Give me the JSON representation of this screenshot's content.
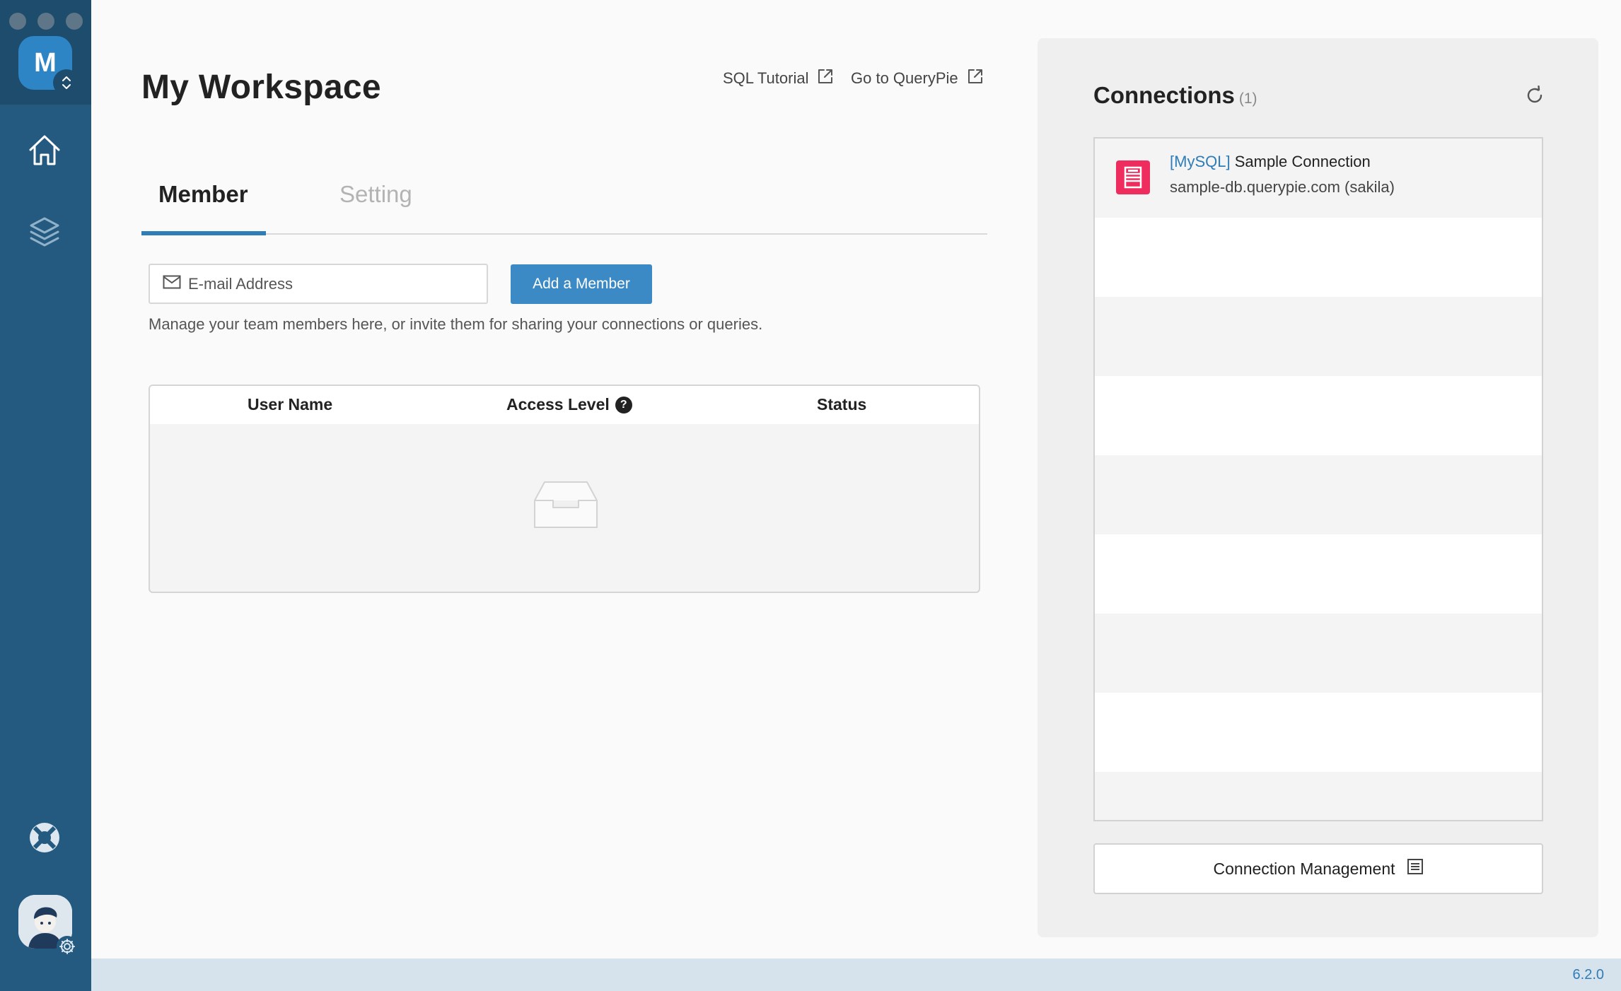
{
  "sidebar": {
    "workspace_initial": "M",
    "nav_items": [
      {
        "name": "home",
        "icon": "home-icon"
      },
      {
        "name": "layers",
        "icon": "layers-icon"
      }
    ],
    "help_icon": "lifebuoy-icon",
    "settings_icon": "gear-icon"
  },
  "header": {
    "title": "My Workspace",
    "links": [
      {
        "label": "SQL Tutorial",
        "icon": "external-link-icon"
      },
      {
        "label": "Go to QueryPie",
        "icon": "external-link-icon"
      }
    ]
  },
  "tabs": [
    {
      "label": "Member",
      "active": true
    },
    {
      "label": "Setting",
      "active": false
    }
  ],
  "member": {
    "email_placeholder": "E-mail Address",
    "email_value": "",
    "add_button": "Add a Member",
    "help_text": "Manage your team members here, or invite them for sharing your connections or queries.",
    "table": {
      "columns": [
        "User Name",
        "Access Level",
        "Status"
      ],
      "access_help": "?",
      "rows": []
    }
  },
  "connections": {
    "title": "Connections",
    "count": "(1)",
    "items": [
      {
        "type_label": "[MySQL]",
        "name": "Sample Connection",
        "host": "sample-db.querypie.com (sakila)"
      }
    ],
    "management_button": "Connection Management"
  },
  "status_bar": {
    "version": "6.2.0"
  },
  "colors": {
    "sidebar": "#245a7f",
    "accent": "#2e7db8",
    "button": "#3b8ac6",
    "db_icon": "#ee2d5e"
  }
}
